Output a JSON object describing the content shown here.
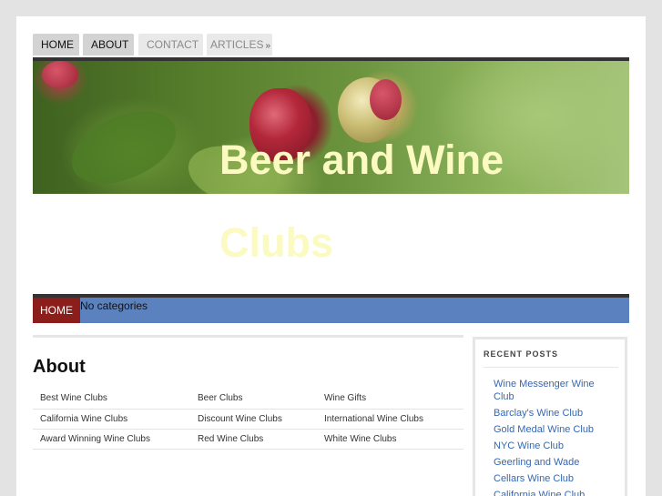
{
  "nav": {
    "home": "HOME",
    "about": "ABOUT",
    "contact": "CONTACT",
    "articles": "ARTICLES",
    "articles_icon": "double-chevron-down-icon"
  },
  "site": {
    "title": "Beer and Wine Clubs"
  },
  "catbar": {
    "home": "HOME",
    "no_categories": "No categories"
  },
  "main": {
    "heading": "About",
    "links": [
      [
        "Best Wine Clubs",
        "Beer Clubs",
        "Wine Gifts"
      ],
      [
        "California Wine Clubs",
        "Discount Wine Clubs",
        "International Wine Clubs"
      ],
      [
        "Award Winning Wine Clubs",
        "Red Wine Clubs",
        "White Wine Clubs"
      ]
    ]
  },
  "sidebar": {
    "title": "RECENT POSTS",
    "posts": [
      "Wine Messenger Wine Club",
      "Barclay's Wine Club",
      "Gold Medal Wine Club",
      "NYC Wine Club",
      "Geerling and Wade",
      "Cellars Wine Club",
      "California Wine Club"
    ]
  },
  "colors": {
    "category_bar": "#5b82bf",
    "home_button": "#8b1e1a",
    "title_text": "#fbfac0",
    "link": "#3567b3"
  }
}
